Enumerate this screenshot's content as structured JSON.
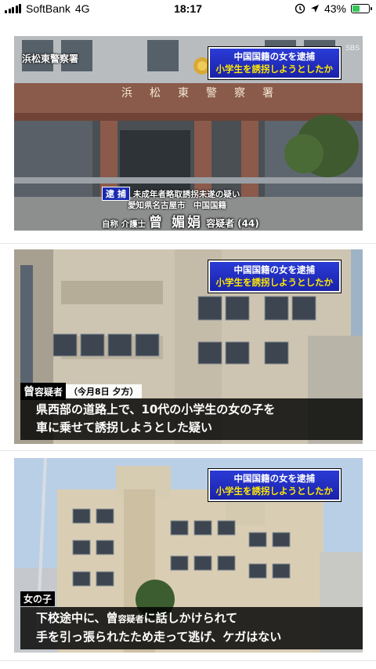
{
  "status_bar": {
    "carrier": "SoftBank",
    "network": "4G",
    "time": "18:17",
    "battery": "43%",
    "battery_level": 0.43
  },
  "captions": {
    "headline_line1": "中国国籍の女を逮捕",
    "headline_line2": "小学生を誘拐しようとしたか",
    "channel": "SBS"
  },
  "card1": {
    "station_tag": "浜松東警察署",
    "sign": "浜松東警察署",
    "arrest_label": "逮 捕",
    "charge": "未成年者略取誘拐未遂の疑い",
    "address": "愛知県名古屋市　中国国籍",
    "self_title": "自称 介護士",
    "name": "曾 媚娟",
    "suffix": "容疑者",
    "age": "(44)"
  },
  "card2": {
    "tag_name": "曾",
    "tag_title": "容疑者",
    "tag_note": "（今月8日 夕方）",
    "line1": "県西部の道路上で、10代の小学生の女の子を",
    "line2": "車に乗せて誘拐しようとした疑い"
  },
  "card3": {
    "tag_label": "女の子",
    "line1_a": "下校途中に、曾",
    "line1_b": "容疑者",
    "line1_c": "に話しかけられて",
    "line2": "手を引っ張られたため走って逃げ、ケガはない"
  },
  "colors": {
    "caption_blue": "#1a2bb0",
    "caption_yellow": "#ffe800",
    "battery_green": "#34c759"
  }
}
